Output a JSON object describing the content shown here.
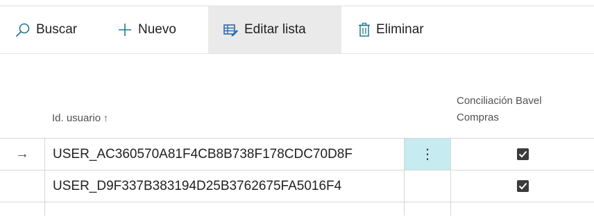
{
  "toolbar": {
    "search_label": "Buscar",
    "new_label": "Nuevo",
    "edit_list_label": "Editar lista",
    "delete_label": "Eliminar",
    "icons": {
      "search": "search-icon",
      "new": "plus-icon",
      "edit_list": "edit-list-icon",
      "delete": "trash-icon"
    },
    "active_item": "edit_list"
  },
  "columns": {
    "user_id": {
      "label": "Id. usuario",
      "sort_indicator": "↑"
    },
    "concil": {
      "label_line1": "Conciliación Bavel",
      "label_line2": "Compras"
    }
  },
  "rows": [
    {
      "user_id": "USER_AC360570A81F4CB8B738F178CDC70D8F",
      "concil_checked": true,
      "selected": true,
      "selector_glyph": "→",
      "menu_glyph": "⋮"
    },
    {
      "user_id": "USER_D9F337B383194D25B3762675FA5016F4",
      "concil_checked": true,
      "selected": false
    }
  ],
  "colors": {
    "active_toolbar_bg": "#eaeaea",
    "row_menu_highlight": "#c6ebf1",
    "icon_blue": "#2b6cb0",
    "icon_teal": "#1e7a8c"
  }
}
